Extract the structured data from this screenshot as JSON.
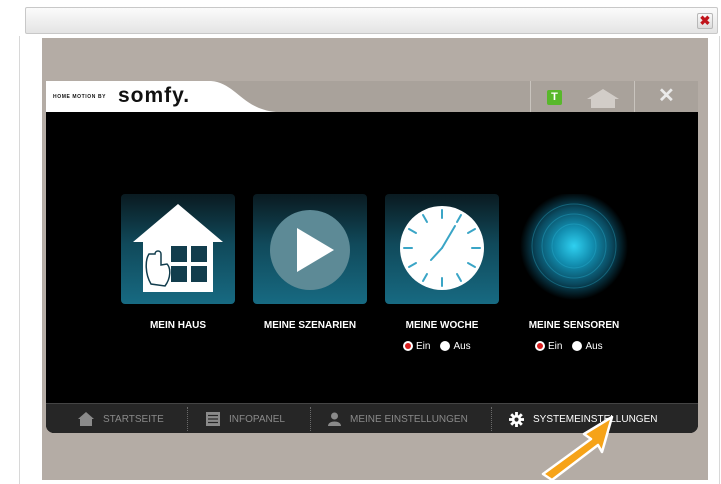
{
  "window": {
    "close_icon": "close-icon",
    "close_glyph": "✖"
  },
  "app": {
    "logo_small": "HOME MOTION BY",
    "logo_brand": "somfy.",
    "t_badge": "T",
    "panel_close_glyph": "✕"
  },
  "tiles": [
    {
      "label": "MEIN HAUS",
      "icon": "house-hand-icon"
    },
    {
      "label": "MEINE SZENARIEN",
      "icon": "play-icon"
    },
    {
      "label": "MEINE WOCHE",
      "icon": "clock-icon",
      "radio": {
        "on": "Ein",
        "off": "Aus",
        "selected": "Ein"
      }
    },
    {
      "label": "MEINE SENSOREN",
      "icon": "sensor-glow-icon",
      "radio": {
        "on": "Ein",
        "off": "Aus",
        "selected": "Ein"
      }
    }
  ],
  "nav": [
    {
      "label": "STARTSEITE",
      "icon": "home-icon",
      "active": false
    },
    {
      "label": "INFOPANEL",
      "icon": "list-icon",
      "active": false
    },
    {
      "label": "MEINE EINSTELLUNGEN",
      "icon": "user-icon",
      "active": false
    },
    {
      "label": "SYSTEMEINSTELLUNGEN",
      "icon": "gear-icon",
      "active": true
    }
  ],
  "colors": {
    "accent_green": "#58b82b",
    "radio_red": "#d81d1d",
    "stage_bg": "#b4aca5",
    "arrow_orange": "#f6a318"
  }
}
